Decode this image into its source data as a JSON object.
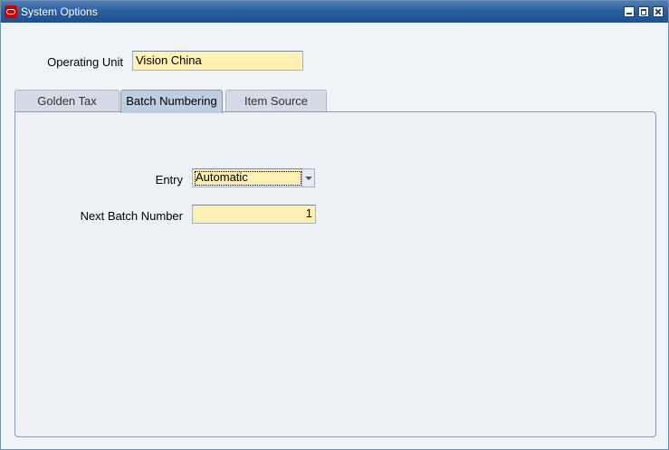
{
  "window": {
    "title": "System Options"
  },
  "form": {
    "operating_unit_label": "Operating Unit",
    "operating_unit_value": "Vision China"
  },
  "tabs": [
    {
      "label": "Golden Tax",
      "active": false
    },
    {
      "label": "Batch Numbering",
      "active": true
    },
    {
      "label": "Item Source",
      "active": false
    }
  ],
  "batch_numbering": {
    "entry_label": "Entry",
    "entry_value": "Automatic",
    "next_batch_label": "Next Batch Number",
    "next_batch_value": "1"
  },
  "colors": {
    "titlebar": "#2d5f9e",
    "field_bg": "#fff1b4",
    "active_tab": "#bfcde0",
    "logo": "#cc0000"
  },
  "icons": {
    "logo": "oracle-logo-icon",
    "minimize": "minimize-icon",
    "maximize": "maximize-icon",
    "close": "close-icon",
    "dropdown": "chevron-down-icon"
  }
}
